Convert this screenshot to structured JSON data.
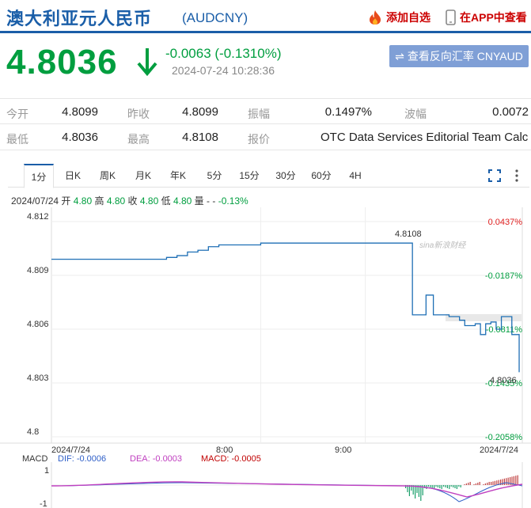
{
  "header": {
    "title": "澳大利亚元人民币",
    "code": "(AUDCNY)",
    "add_favorite": "添加自选",
    "view_in_app": "在APP中查看"
  },
  "quote": {
    "price": "4.8036",
    "change": "-0.0063 (-0.1310%)",
    "timestamp": "2024-07-24 10:28:36",
    "reverse_button": "查看反向汇率 CNYAUD",
    "down_color": "#009e3f"
  },
  "stats": {
    "open_label": "今开",
    "open": "4.8099",
    "prev_close_label": "昨收",
    "prev_close": "4.8099",
    "amplitude_label": "振幅",
    "amplitude": "0.1497%",
    "volatility_label": "波幅",
    "volatility": "0.0072",
    "low_label": "最低",
    "low": "4.8036",
    "high_label": "最高",
    "high": "4.8108",
    "quote_source_label": "报价",
    "quote_source": "OTC Data Services Editorial Team Calc..."
  },
  "tabs": [
    "1分",
    "日K",
    "周K",
    "月K",
    "年K",
    "5分",
    "15分",
    "30分",
    "60分",
    "4H"
  ],
  "ohlc": {
    "date": "2024/07/24",
    "open_label": "开",
    "open": "4.80",
    "high_label": "高",
    "high": "4.80",
    "close_label": "收",
    "close": "4.80",
    "low_label": "低",
    "low": "4.80",
    "volume_label": "量",
    "volume": "-",
    "change": "-0.13%"
  },
  "chart_data": {
    "type": "line",
    "y_ticks": [
      "4.812",
      "4.809",
      "4.806",
      "4.803",
      "4.8"
    ],
    "right_ticks": [
      "0.0437%",
      "-0.0187%",
      "-0.0811%",
      "-0.1435%",
      "-0.2058%"
    ],
    "x_ticks": [
      "2024/7/24",
      "8:00",
      "9:00",
      "2024/7/24"
    ],
    "ylim": [
      4.8,
      4.812
    ],
    "high_label": "4.8108",
    "last_label": "4.8036",
    "watermark": "sina新浪财经",
    "grid": true,
    "series": [
      {
        "x": [
          6.0,
          6.5,
          6.8,
          7.0,
          7.1,
          7.2,
          7.3,
          7.4,
          7.5,
          7.6,
          8.0,
          8.5,
          9.0,
          9.2,
          9.3,
          9.35,
          9.45,
          9.52,
          9.58,
          9.65,
          9.7,
          9.8,
          9.9,
          9.95,
          10.0,
          10.05,
          10.1,
          10.15,
          10.2,
          10.25,
          10.3,
          10.35,
          10.4,
          10.45,
          10.47
        ],
        "y": [
          4.8099,
          4.8099,
          4.8099,
          4.8099,
          4.81,
          4.8101,
          4.8103,
          4.8104,
          4.8106,
          4.8107,
          4.8108,
          4.8108,
          4.8108,
          4.8108,
          4.8108,
          4.8108,
          4.8068,
          4.8068,
          4.8079,
          4.8068,
          4.8068,
          4.8067,
          4.8065,
          4.8062,
          4.8062,
          4.8063,
          4.8057,
          4.8063,
          4.8064,
          4.806,
          4.8067,
          4.8067,
          4.8057,
          4.8057,
          4.8036
        ]
      }
    ],
    "xlim": [
      6.0,
      10.5
    ]
  },
  "macd": {
    "label": "MACD",
    "dif": "DIF: -0.0006",
    "dea": "DEA: -0.0003",
    "macd": "MACD: -0.0005",
    "y_top": "1",
    "y_bottom": "-1",
    "dif_color": "#3060c8",
    "dea_color": "#c040c0",
    "macd_color": "#c00000"
  }
}
